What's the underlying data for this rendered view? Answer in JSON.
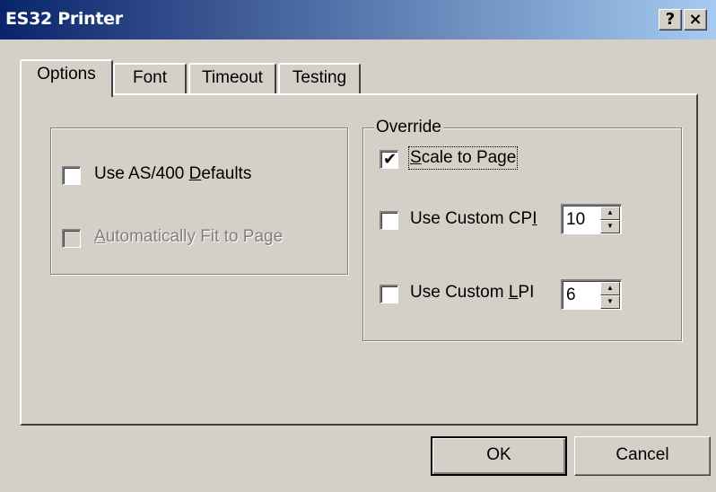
{
  "window": {
    "title": "ES32 Printer"
  },
  "titlebar_buttons": {
    "help": "?",
    "close": "×"
  },
  "tabs": [
    {
      "label": "Options",
      "active": true
    },
    {
      "label": "Font",
      "active": false
    },
    {
      "label": "Timeout",
      "active": false
    },
    {
      "label": "Testing",
      "active": false
    }
  ],
  "defaults_group": {
    "use_as400_defaults": {
      "label_pre": "Use AS/400 ",
      "label_ul": "D",
      "label_post": "efaults",
      "checked": false,
      "enabled": true
    },
    "auto_fit": {
      "label_pre": "",
      "label_ul": "A",
      "label_post": "utomatically Fit to Page",
      "checked": false,
      "enabled": false
    }
  },
  "override_group": {
    "legend": "Override",
    "scale_to_page": {
      "label_pre": "",
      "label_ul": "S",
      "label_post": "cale to Page",
      "checked": true,
      "check_glyph": "✔"
    },
    "custom_cpi": {
      "label_pre": "Use Custom CP",
      "label_ul": "I",
      "label_post": "",
      "checked": false,
      "value": "10"
    },
    "custom_lpi": {
      "label_pre": "Use Custom ",
      "label_ul": "L",
      "label_post": "PI",
      "checked": false,
      "value": "6"
    }
  },
  "spinner_arrows": {
    "up": "▲",
    "down": "▼"
  },
  "buttons": {
    "ok": "OK",
    "cancel": "Cancel"
  },
  "colors": {
    "titlebar_start": "#0a246a",
    "titlebar_end": "#a6caf0",
    "face": "#d4d0c8"
  }
}
